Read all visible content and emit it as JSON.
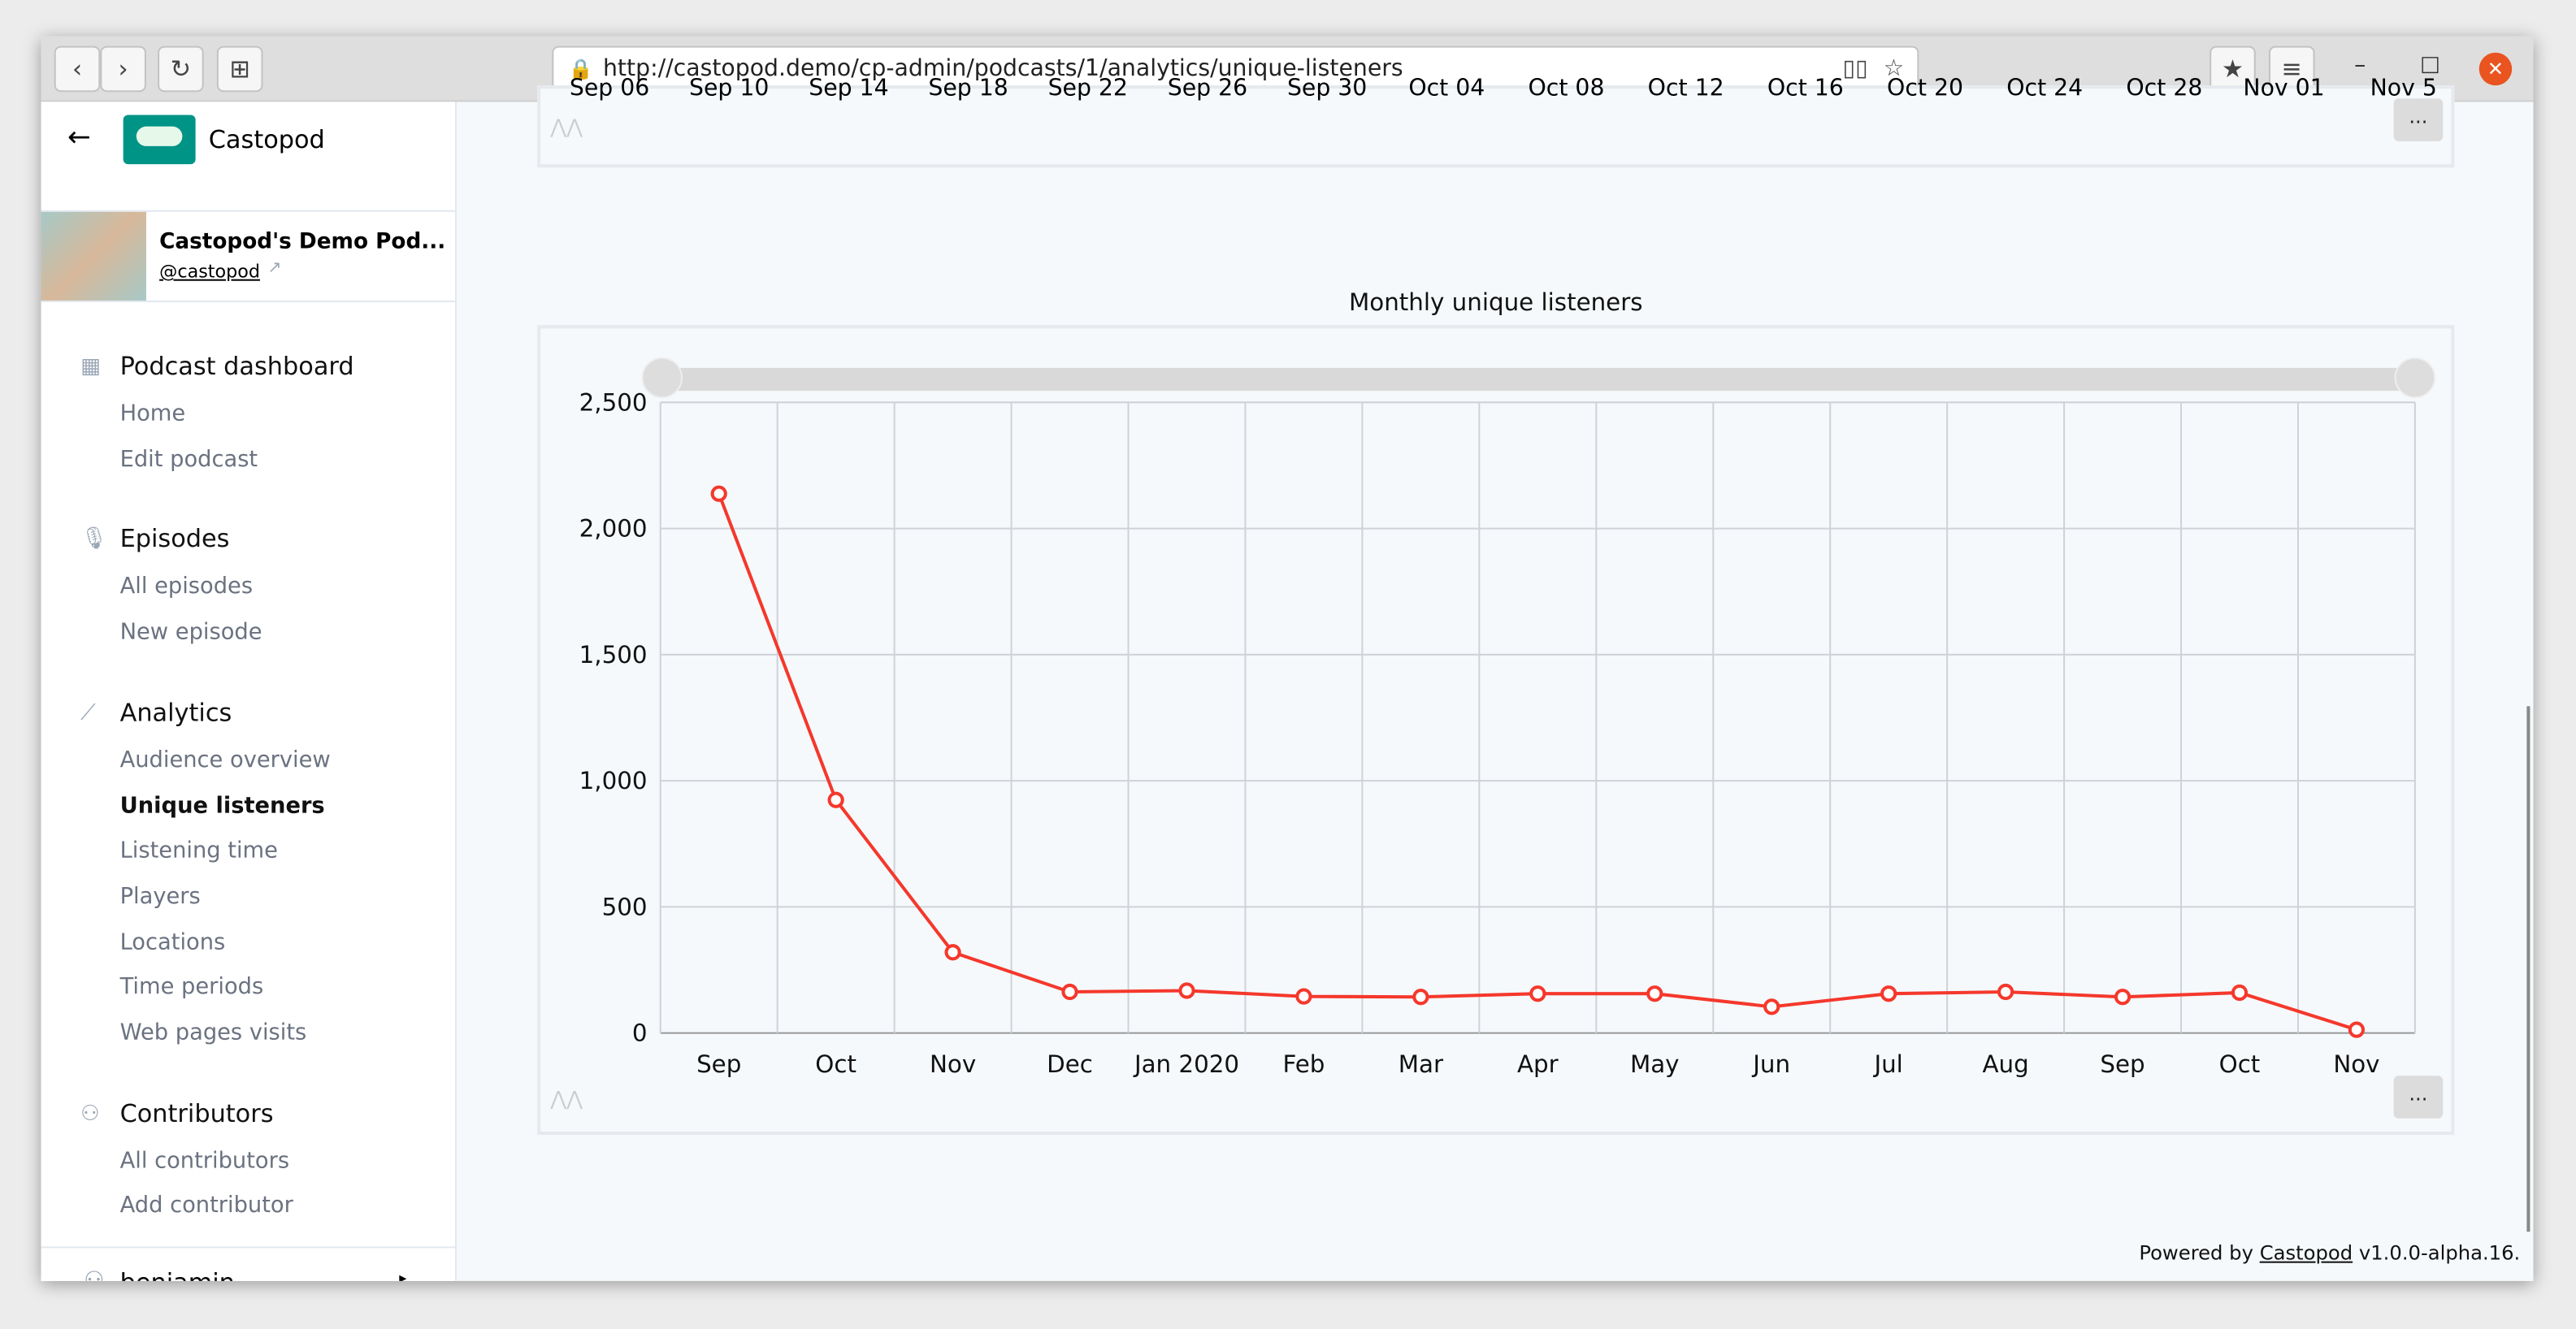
{
  "browser": {
    "url": "http://castopod.demo/cp-admin/podcasts/1/analytics/unique-listeners"
  },
  "sidebar": {
    "brand": "Castopod",
    "podcast_title": "Castopod's Demo Pod...",
    "podcast_handle": "@castopod",
    "sections": [
      {
        "label": "Podcast dashboard",
        "icon": "dashboard-icon",
        "items": [
          "Home",
          "Edit podcast"
        ]
      },
      {
        "label": "Episodes",
        "icon": "microphone-icon",
        "items": [
          "All episodes",
          "New episode"
        ]
      },
      {
        "label": "Analytics",
        "icon": "line-chart-icon",
        "items": [
          "Audience overview",
          "Unique listeners",
          "Listening time",
          "Players",
          "Locations",
          "Time periods",
          "Web pages visits"
        ]
      },
      {
        "label": "Contributors",
        "icon": "users-icon",
        "items": [
          "All contributors",
          "Add contributor"
        ]
      }
    ],
    "active_item": "Unique listeners",
    "user": "benjamin"
  },
  "top_chart": {
    "tick_labels": [
      "Sep 06",
      "Sep 10",
      "Sep 14",
      "Sep 18",
      "Sep 22",
      "Sep 26",
      "Sep 30",
      "Oct 04",
      "Oct 08",
      "Oct 12",
      "Oct 16",
      "Oct 20",
      "Oct 24",
      "Oct 28",
      "Nov 01",
      "Nov 5"
    ],
    "more_label": "..."
  },
  "chart_data": {
    "type": "line",
    "title": "Monthly unique listeners",
    "categories": [
      "Sep",
      "Oct",
      "Nov",
      "Dec",
      "Jan 2020",
      "Feb",
      "Mar",
      "Apr",
      "May",
      "Jun",
      "Jul",
      "Aug",
      "Sep",
      "Oct",
      "Nov"
    ],
    "values": [
      2138,
      924,
      320,
      163,
      168,
      145,
      143,
      156,
      156,
      104,
      156,
      163,
      143,
      160,
      13
    ],
    "ylim": [
      0,
      2500
    ],
    "yticks": [
      0,
      500,
      1000,
      1500,
      2000,
      2500
    ],
    "ytick_labels": [
      "0",
      "500",
      "1,000",
      "1,500",
      "2,000",
      "2,500"
    ],
    "grid": true,
    "line_color": "#f5382c",
    "more_label": "..."
  },
  "footer": {
    "prefix": "Powered by",
    "link": "Castopod",
    "version": "v1.0.0-alpha.16."
  },
  "colors": {
    "brand": "#009486",
    "accent": "#f5382c"
  }
}
